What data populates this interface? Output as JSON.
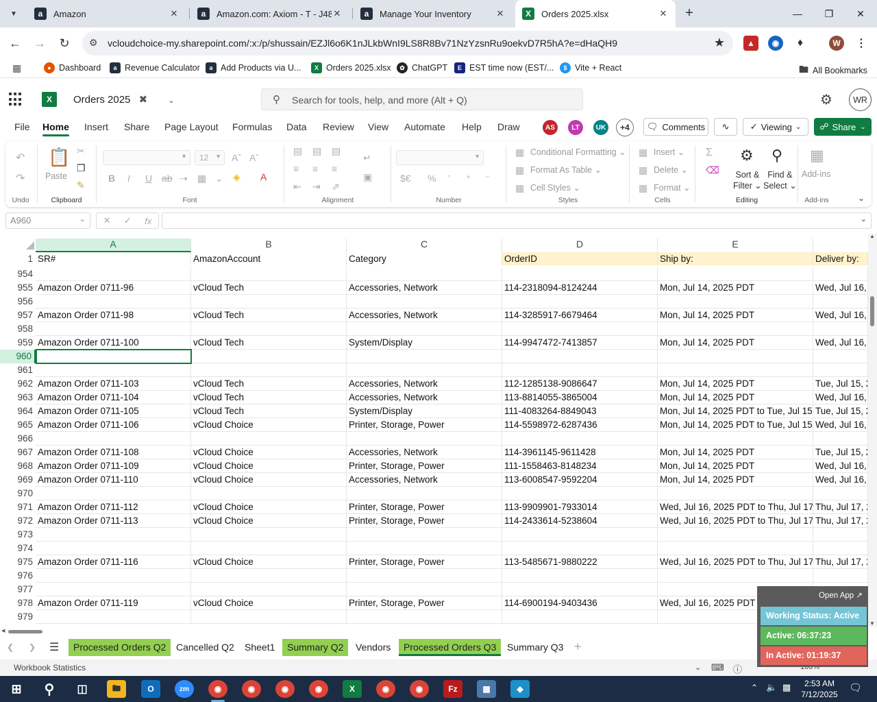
{
  "browser": {
    "tabs": [
      {
        "title": "Amazon",
        "icon": "amazon-icon",
        "color": "#232f3e"
      },
      {
        "title": "Amazon.com: Axiom - T - J485",
        "icon": "amazon-icon",
        "color": "#232f3e"
      },
      {
        "title": "Manage Your Inventory",
        "icon": "amazon-icon",
        "color": "#232f3e"
      },
      {
        "title": "Orders 2025.xlsx",
        "icon": "excel-icon",
        "color": "#107c41"
      }
    ],
    "url": "vcloudchoice-my.sharepoint.com/:x:/p/shussain/EZJl6o6K1nJLkbWnI9LS8R8Bv71NzYzsnRu9oekvD7R5hA?e=dHaQH9",
    "bookmarks": [
      "Dashboard",
      "Revenue Calculator",
      "Add Products via U...",
      "Orders 2025.xlsx",
      "ChatGPT",
      "EST time now (EST/...",
      "Vite + React"
    ],
    "all_bookmarks": "All Bookmarks",
    "profile_initial": "W"
  },
  "excel": {
    "doc_name": "Orders 2025",
    "search_placeholder": "Search for tools, help, and more (Alt + Q)",
    "user_initials": "WR",
    "ribbon_tabs": [
      "File",
      "Home",
      "Insert",
      "Share",
      "Page Layout",
      "Formulas",
      "Data",
      "Review",
      "View",
      "Automate",
      "Help",
      "Draw"
    ],
    "active_tab": "Home",
    "collaborators": [
      {
        "initials": "AS",
        "color": "#c4262e"
      },
      {
        "initials": "LT",
        "color": "#c239b3"
      },
      {
        "initials": "UK",
        "color": "#038387"
      }
    ],
    "more_collaborators": "+4",
    "comments_label": "Comments",
    "viewing_label": "Viewing",
    "share_label": "Share",
    "ribbon": {
      "undo_group": "Undo",
      "clipboard_group": "Clipboard",
      "paste_label": "Paste",
      "font_group": "Font",
      "font_size": "12",
      "alignment_group": "Alignment",
      "number_group": "Number",
      "styles_group": "Styles",
      "conditional_formatting": "Conditional Formatting",
      "format_as_table": "Format As Table",
      "cell_styles": "Cell Styles",
      "cells_group": "Cells",
      "insert": "Insert",
      "delete": "Delete",
      "format": "Format",
      "editing_group": "Editing",
      "sort_filter_1": "Sort &",
      "sort_filter_2": "Filter",
      "find_select_1": "Find &",
      "find_select_2": "Select",
      "addins_group": "Add-ins",
      "addins_label_1": "Add-ins"
    },
    "name_box": "A960",
    "fx_label": "fx",
    "columns": [
      "A",
      "B",
      "C",
      "D",
      "E"
    ],
    "header_row_number": "1",
    "header_row": [
      "SR#",
      "AmazonAccount",
      "Category",
      "OrderID",
      "Ship by:",
      "Deliver by:"
    ],
    "rows": [
      {
        "n": "954",
        "c": [
          "",
          "",
          "",
          "",
          "",
          ""
        ]
      },
      {
        "n": "955",
        "c": [
          "Amazon Order 0711-96",
          "vCloud Tech",
          "Accessories, Network",
          "114-2318094-8124244",
          "Mon, Jul 14, 2025 PDT",
          "Wed, Jul 16, 2"
        ]
      },
      {
        "n": "956",
        "c": [
          "",
          "",
          "",
          "",
          "",
          ""
        ]
      },
      {
        "n": "957",
        "c": [
          "Amazon Order 0711-98",
          "vCloud Tech",
          "Accessories, Network",
          "114-3285917-6679464",
          "Mon, Jul 14, 2025 PDT",
          "Wed, Jul 16, 2"
        ]
      },
      {
        "n": "958",
        "c": [
          "",
          "",
          "",
          "",
          "",
          ""
        ]
      },
      {
        "n": "959",
        "c": [
          "Amazon Order 0711-100",
          "vCloud Tech",
          "System/Display",
          "114-9947472-7413857",
          "Mon, Jul 14, 2025 PDT",
          "Wed, Jul 16, 2"
        ]
      },
      {
        "n": "960",
        "c": [
          "",
          "",
          "",
          "",
          "",
          ""
        ]
      },
      {
        "n": "961",
        "c": [
          "",
          "",
          "",
          "",
          "",
          ""
        ]
      },
      {
        "n": "962",
        "c": [
          "Amazon Order 0711-103",
          "vCloud Tech",
          "Accessories, Network",
          "112-1285138-9086647",
          "Mon, Jul 14, 2025 PDT",
          "Tue, Jul 15, 20"
        ]
      },
      {
        "n": "963",
        "c": [
          "Amazon Order 0711-104",
          "vCloud Tech",
          "Accessories, Network",
          "113-8814055-3865004",
          "Mon, Jul 14, 2025 PDT",
          "Wed, Jul 16, 2"
        ]
      },
      {
        "n": "964",
        "c": [
          "Amazon Order 0711-105",
          "vCloud Tech",
          "System/Display",
          "111-4083264-8849043",
          "Mon, Jul 14, 2025 PDT to Tue, Jul 15, 2",
          "Tue, Jul 15, 20"
        ]
      },
      {
        "n": "965",
        "c": [
          "Amazon Order 0711-106",
          "vCloud Choice",
          "Printer, Storage, Power",
          "114-5598972-6287436",
          "Mon, Jul 14, 2025 PDT to Tue, Jul 15, 2",
          "Wed, Jul 16, 2"
        ]
      },
      {
        "n": "966",
        "c": [
          "",
          "",
          "",
          "",
          "",
          ""
        ]
      },
      {
        "n": "967",
        "c": [
          "Amazon Order 0711-108",
          "vCloud Choice",
          "Accessories, Network",
          "114-3961145-9611428",
          "Mon, Jul 14, 2025 PDT",
          "Tue, Jul 15, 20"
        ]
      },
      {
        "n": "968",
        "c": [
          "Amazon Order 0711-109",
          "vCloud Choice",
          "Printer, Storage, Power",
          "111-1558463-8148234",
          "Mon, Jul 14, 2025 PDT",
          "Wed, Jul 16, 2"
        ]
      },
      {
        "n": "969",
        "c": [
          "Amazon Order 0711-110",
          "vCloud Choice",
          "Accessories, Network",
          "113-6008547-9592204",
          "Mon, Jul 14, 2025 PDT",
          "Wed, Jul 16, 2"
        ]
      },
      {
        "n": "970",
        "c": [
          "",
          "",
          "",
          "",
          "",
          ""
        ]
      },
      {
        "n": "971",
        "c": [
          "Amazon Order 0711-112",
          "vCloud Choice",
          "Printer, Storage, Power",
          "113-9909901-7933014",
          "Wed, Jul 16, 2025 PDT to Thu, Jul 17, 2",
          "Thu, Jul 17, 2"
        ]
      },
      {
        "n": "972",
        "c": [
          "Amazon Order 0711-113",
          "vCloud Choice",
          "Printer, Storage, Power",
          "114-2433614-5238604",
          "Wed, Jul 16, 2025 PDT to Thu, Jul 17, 2",
          "Thu, Jul 17, 2"
        ]
      },
      {
        "n": "973",
        "c": [
          "",
          "",
          "",
          "",
          "",
          ""
        ]
      },
      {
        "n": "974",
        "c": [
          "",
          "",
          "",
          "",
          "",
          ""
        ]
      },
      {
        "n": "975",
        "c": [
          "Amazon Order 0711-116",
          "vCloud Choice",
          "Printer, Storage, Power",
          "113-5485671-9880222",
          "Wed, Jul 16, 2025 PDT to Thu, Jul 17, 2",
          "Thu, Jul 17, 2"
        ]
      },
      {
        "n": "976",
        "c": [
          "",
          "",
          "",
          "",
          "",
          ""
        ]
      },
      {
        "n": "977",
        "c": [
          "",
          "",
          "",
          "",
          "",
          ""
        ]
      },
      {
        "n": "978",
        "c": [
          "Amazon Order 0711-119",
          "vCloud Choice",
          "Printer, Storage, Power",
          "114-6900194-9403436",
          "Wed, Jul 16, 2025 PDT to Thu, Jul 17, 2",
          "Thu, Jul 17, 2"
        ]
      },
      {
        "n": "979",
        "c": [
          "",
          "",
          "",
          "",
          "",
          ""
        ]
      }
    ],
    "sheets": [
      {
        "name": "Processed Orders Q2",
        "green": true,
        "active": false
      },
      {
        "name": "Cancelled Q2",
        "green": false,
        "active": false
      },
      {
        "name": "Sheet1",
        "green": false,
        "active": false
      },
      {
        "name": "Summary Q2",
        "green": true,
        "active": false
      },
      {
        "name": "Vendors",
        "green": false,
        "active": false
      },
      {
        "name": "Processed Orders Q3",
        "green": true,
        "active": true
      },
      {
        "name": "Summary Q3",
        "green": false,
        "active": false
      }
    ],
    "status_text": "Workbook Statistics",
    "zoom": "100%"
  },
  "widget": {
    "open_app": "Open App ↗",
    "working_status": "Working Status: Active",
    "active_time": "Active: 06:37:23",
    "inactive_time": "In Active: 01:19:37",
    "colors": {
      "status": "#74c5d6",
      "active": "#5cb85c",
      "inactive": "#e2655b"
    }
  },
  "taskbar": {
    "time": "2:53 AM",
    "date": "7/12/2025"
  }
}
